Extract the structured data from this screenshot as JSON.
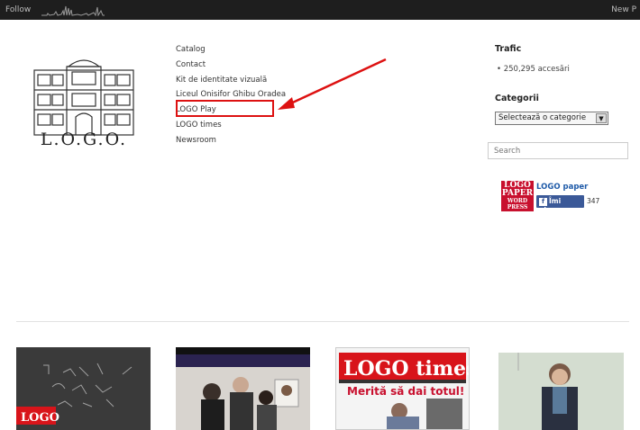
{
  "topbar": {
    "follow": "Follow",
    "right_text": "New P"
  },
  "logo": {
    "text": "L.O.G.O."
  },
  "menu": {
    "items": [
      "Catalog",
      "Contact",
      "Kit de identitate vizuală",
      "Liceul Onisifor Ghibu Oradea",
      "LOGO Play",
      "LOGO times",
      "Newsroom"
    ]
  },
  "sidebar": {
    "trafic_title": "Trafic",
    "trafic_value": "250,295 accesări",
    "categorii_title": "Categorii",
    "select_value": "Selectează o categorie",
    "search_placeholder": "Search",
    "paper_title": "LOGO paper",
    "paper_logo_lines": [
      "LOGO",
      "PAPER",
      "WORD",
      "PRESS"
    ],
    "like_label": "Îmi place",
    "like_count": "347"
  },
  "thumbnails": {
    "t1_caption": "LOGO",
    "t3_title": "LOGO times",
    "t3_headline": "Merită să dai totul!"
  },
  "colors": {
    "highlight": "#dd1111",
    "topbar": "#1e1e1e",
    "facebook": "#3b5998",
    "brand_red": "#c8102e"
  }
}
